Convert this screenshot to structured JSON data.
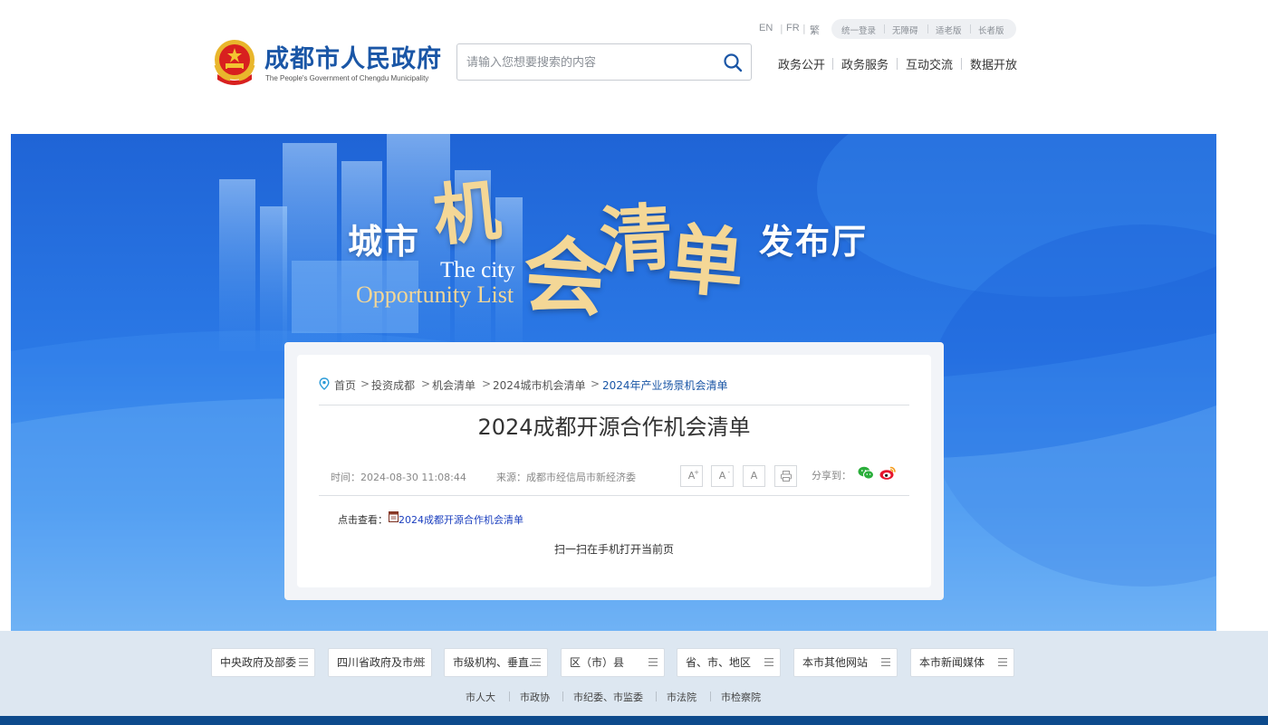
{
  "header": {
    "site_name_cn": "成都市人民政府",
    "site_name_en": "The People's Government of Chengdu Municipality",
    "search_placeholder": "请输入您想要搜索的内容",
    "languages": [
      "EN",
      "FR",
      "繁"
    ],
    "accessibility": [
      "统一登录",
      "无障碍",
      "适老版",
      "长者版"
    ],
    "nav": [
      "政务公开",
      "政务服务",
      "互动交流",
      "数据开放"
    ]
  },
  "banner": {
    "left_cn": "城市",
    "calligraphy": [
      "机",
      "会",
      "清",
      "单"
    ],
    "right_cn": "发布厅",
    "en_line1": "The city",
    "en_line2": "Opportunity List"
  },
  "breadcrumb": [
    "首页",
    "投资成都",
    "机会清单",
    "2024城市机会清单",
    "2024年产业场景机会清单"
  ],
  "article": {
    "title": "2024成都开源合作机会清单",
    "time": "时间：2024-08-30 11:08:44",
    "source": "来源：成都市经信局市新经济委",
    "font_buttons": [
      "A",
      "A",
      "A"
    ],
    "font_button_marks": [
      "+",
      "-"
    ],
    "share_label": "分享到：",
    "view_label": "点击查看：",
    "attachment": "2024成都开源合作机会清单",
    "scan_text": "扫一扫在手机打开当前页"
  },
  "footer": {
    "link_groups": [
      "中央政府及部委",
      "四川省政府及市州",
      "市级机构、垂直...",
      "区（市）县",
      "省、市、地区",
      "本市其他网站",
      "本市新闻媒体"
    ],
    "bottom_links": [
      "市人大",
      "市政协",
      "市纪委、市监委",
      "市法院",
      "市检察院"
    ]
  },
  "colors": {
    "brand_blue": "#1a56a6",
    "banner_blue": "#2b79e6",
    "gold": "#f4d796",
    "footer_band": "#dde7f1",
    "footer_bottom": "#0d4a8c",
    "link_blue": "#1b3fbf",
    "wechat_green": "#2aae3a",
    "weibo_red": "#e6162d"
  },
  "icons": [
    "national-emblem-icon",
    "search-icon",
    "location-pin-icon",
    "print-icon",
    "wechat-icon",
    "weibo-icon",
    "document-icon",
    "menu-lines-icon"
  ]
}
